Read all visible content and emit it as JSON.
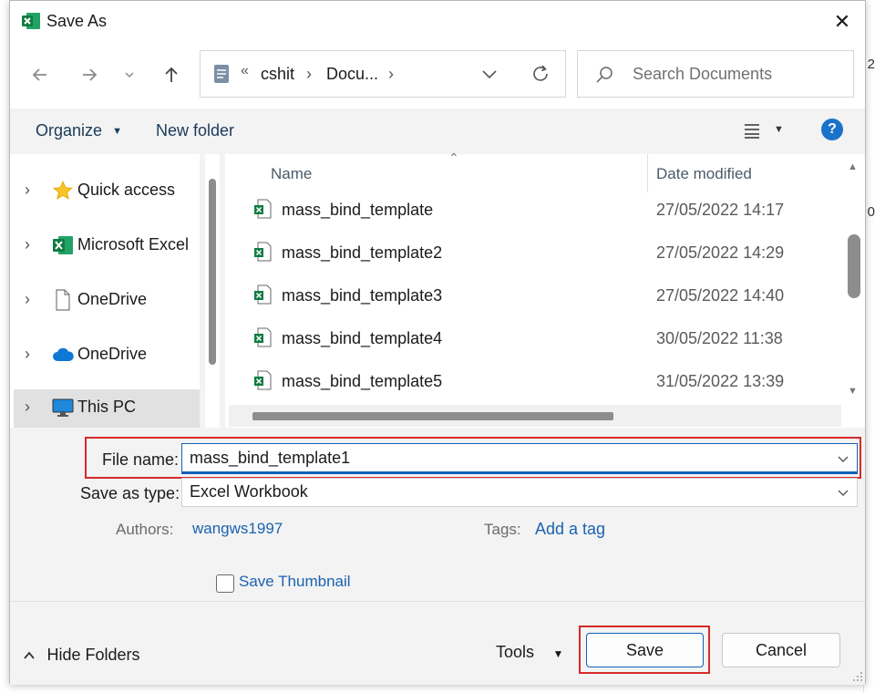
{
  "window": {
    "title": "Save As",
    "close_label": "✕"
  },
  "nav": {
    "breadcrumb": {
      "overflow": "«",
      "crumbs": [
        "cshit",
        "Docu..."
      ],
      "sep": "›"
    },
    "search_placeholder": "Search Documents"
  },
  "toolbar": {
    "organize_label": "Organize",
    "new_folder_label": "New folder",
    "help_label": "?"
  },
  "sidebar": {
    "items": [
      {
        "label": "Quick access",
        "icon": "star-icon"
      },
      {
        "label": "Microsoft Excel",
        "icon": "excel-icon"
      },
      {
        "label": "OneDrive",
        "icon": "document-icon"
      },
      {
        "label": "OneDrive",
        "icon": "cloud-icon"
      },
      {
        "label": "This PC",
        "icon": "monitor-icon"
      }
    ],
    "chevron": "›"
  },
  "files": {
    "columns": {
      "name": "Name",
      "date": "Date modified"
    },
    "rows": [
      {
        "name": "mass_bind_template",
        "date": "27/05/2022 14:17"
      },
      {
        "name": "mass_bind_template2",
        "date": "27/05/2022 14:29"
      },
      {
        "name": "mass_bind_template3",
        "date": "27/05/2022 14:40"
      },
      {
        "name": "mass_bind_template4",
        "date": "30/05/2022 11:38"
      },
      {
        "name": "mass_bind_template5",
        "date": "31/05/2022 13:39"
      }
    ]
  },
  "form": {
    "filename_label": "File name:",
    "filename_value": "mass_bind_template1",
    "savetype_label": "Save as type:",
    "savetype_value": "Excel Workbook",
    "authors_label": "Authors:",
    "authors_value": "wangws1997",
    "tags_label": "Tags:",
    "tags_value": "Add a tag",
    "thumbnail_label": "Save Thumbnail"
  },
  "footer": {
    "hide_folders_label": "Hide Folders",
    "tools_label": "Tools",
    "save_label": "Save",
    "cancel_label": "Cancel"
  },
  "colors": {
    "accent": "#1a73c8",
    "highlight": "#d62a2a",
    "excel_green": "#1e7145"
  }
}
